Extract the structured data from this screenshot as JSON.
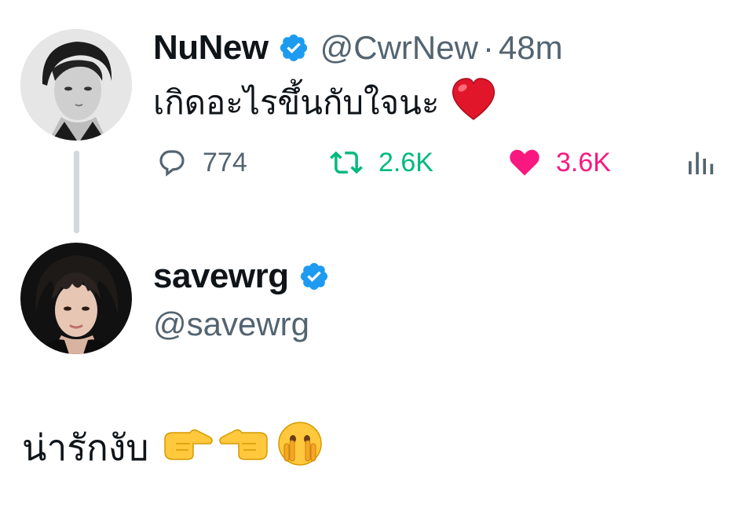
{
  "original_tweet": {
    "display_name": "NuNew",
    "handle": "@CwrNew",
    "separator": "·",
    "time": "48m",
    "text": "เกิดอะไรขึ้นกับใจนะ",
    "emoji": "red-heart-emoji",
    "stats": {
      "replies": "774",
      "retweets": "2.6K",
      "likes": "3.6K"
    },
    "liked": true,
    "retweeted": true
  },
  "reply_tweet": {
    "display_name": "savewrg",
    "handle": "@savewrg",
    "text": "น่ารักงับ",
    "emojis": [
      "backhand-index-pointing-right-emoji",
      "backhand-index-pointing-left-emoji",
      "face-with-open-eyes-and-hand-over-mouth-emoji"
    ]
  },
  "colors": {
    "text_primary": "#0f1419",
    "text_secondary": "#536471",
    "verified_blue": "#1d9bf0",
    "retweet_green": "#00ba7c",
    "like_pink": "#f91880",
    "thread_line": "#cfd9de"
  }
}
